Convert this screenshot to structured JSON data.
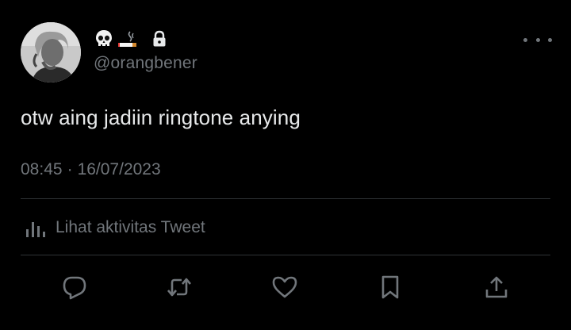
{
  "author": {
    "display_emojis": [
      "skull-icon",
      "cigarette-icon"
    ],
    "protected_icon": "lock-icon",
    "handle": "@orangbener"
  },
  "tweet": {
    "text": "otw aing jadiin ringtone anying",
    "time": "08:45",
    "separator": "·",
    "date": "16/07/2023"
  },
  "activity": {
    "icon": "analytics-icon",
    "label": "Lihat aktivitas Tweet"
  },
  "actions": [
    {
      "name": "reply",
      "icon": "reply-icon"
    },
    {
      "name": "retweet",
      "icon": "retweet-icon"
    },
    {
      "name": "like",
      "icon": "heart-icon"
    },
    {
      "name": "bookmark",
      "icon": "bookmark-icon"
    },
    {
      "name": "share",
      "icon": "share-icon"
    }
  ],
  "colors": {
    "background": "#000000",
    "text_primary": "#e7e9ea",
    "text_secondary": "#71767b",
    "divider": "#2f3336"
  }
}
